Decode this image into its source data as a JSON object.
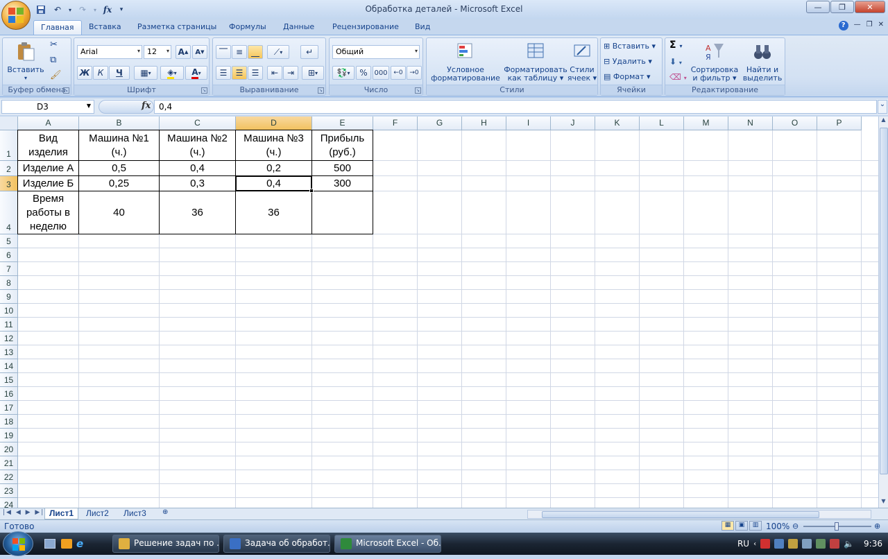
{
  "window": {
    "title": "Обработка деталей - Microsoft Excel"
  },
  "qat": {
    "save_icon": "save-icon",
    "undo_icon": "undo-icon",
    "redo_icon": "redo-icon",
    "fx_label": "fx"
  },
  "tabs": [
    {
      "label": "Главная",
      "active": true
    },
    {
      "label": "Вставка"
    },
    {
      "label": "Разметка страницы"
    },
    {
      "label": "Формулы"
    },
    {
      "label": "Данные"
    },
    {
      "label": "Рецензирование"
    },
    {
      "label": "Вид"
    }
  ],
  "ribbon": {
    "clipboard": {
      "label": "Буфер обмена",
      "paste": "Вставить"
    },
    "font": {
      "label": "Шрифт",
      "name": "Arial",
      "size": "12",
      "bold": "Ж",
      "italic": "К",
      "underline": "Ч",
      "grow": "A",
      "shrink": "A",
      "fontcolor": "A"
    },
    "align": {
      "label": "Выравнивание"
    },
    "number": {
      "label": "Число",
      "format": "Общий",
      "percent": "%",
      "thousands": "000"
    },
    "styles": {
      "label": "Стили",
      "cond_format_1": "Условное",
      "cond_format_2": "форматирование",
      "table_format_1": "Форматировать",
      "table_format_2": "как таблицу",
      "cell_styles_1": "Стили",
      "cell_styles_2": "ячеек"
    },
    "cells": {
      "label": "Ячейки",
      "insert": "Вставить",
      "delete": "Удалить",
      "format": "Формат"
    },
    "editing": {
      "label": "Редактирование",
      "sigma": "Σ",
      "sort_1": "Сортировка",
      "sort_2": "и фильтр",
      "find_1": "Найти и",
      "find_2": "выделить"
    }
  },
  "formula_bar": {
    "name_box": "D3",
    "fx": "fx",
    "value": "0,4"
  },
  "columns": [
    "A",
    "B",
    "C",
    "D",
    "E",
    "F",
    "G",
    "H",
    "I",
    "J",
    "K",
    "L",
    "M",
    "N",
    "O",
    "P"
  ],
  "rows": [
    "1",
    "2",
    "3",
    "4",
    "5",
    "6",
    "7",
    "8",
    "9",
    "10",
    "11",
    "12",
    "13",
    "14",
    "15",
    "16",
    "17",
    "18",
    "19",
    "20",
    "21",
    "22",
    "23",
    "24"
  ],
  "selected": {
    "column": "D",
    "row": "3"
  },
  "cells": {
    "A1": "Вид изделия",
    "B1": "Машина №1 (ч.)",
    "C1": "Машина №2 (ч.)",
    "D1": "Машина №3 (ч.)",
    "E1": "Прибыль (руб.)",
    "A2": "Изделие А",
    "B2": "0,5",
    "C2": "0,4",
    "D2": "0,2",
    "E2": "500",
    "A3": "Изделие Б",
    "B3": "0,25",
    "C3": "0,3",
    "D3": "0,4",
    "E3": "300",
    "A4": "Время работы в неделю",
    "B4": "40",
    "C4": "36",
    "D4": "36",
    "E4": ""
  },
  "sheets": [
    {
      "label": "Лист1",
      "active": true
    },
    {
      "label": "Лист2"
    },
    {
      "label": "Лист3"
    }
  ],
  "status": {
    "ready": "Готово",
    "zoom": "100%"
  },
  "taskbar": {
    "items": [
      {
        "label": "Решение задач по ...",
        "color": "#e0b040"
      },
      {
        "label": "Задача об обработ...",
        "color": "#3a6fc4"
      },
      {
        "label": "Microsoft Excel - Об...",
        "color": "#2f8a3c",
        "active": true
      }
    ],
    "lang": "RU",
    "clock": "9:36"
  }
}
